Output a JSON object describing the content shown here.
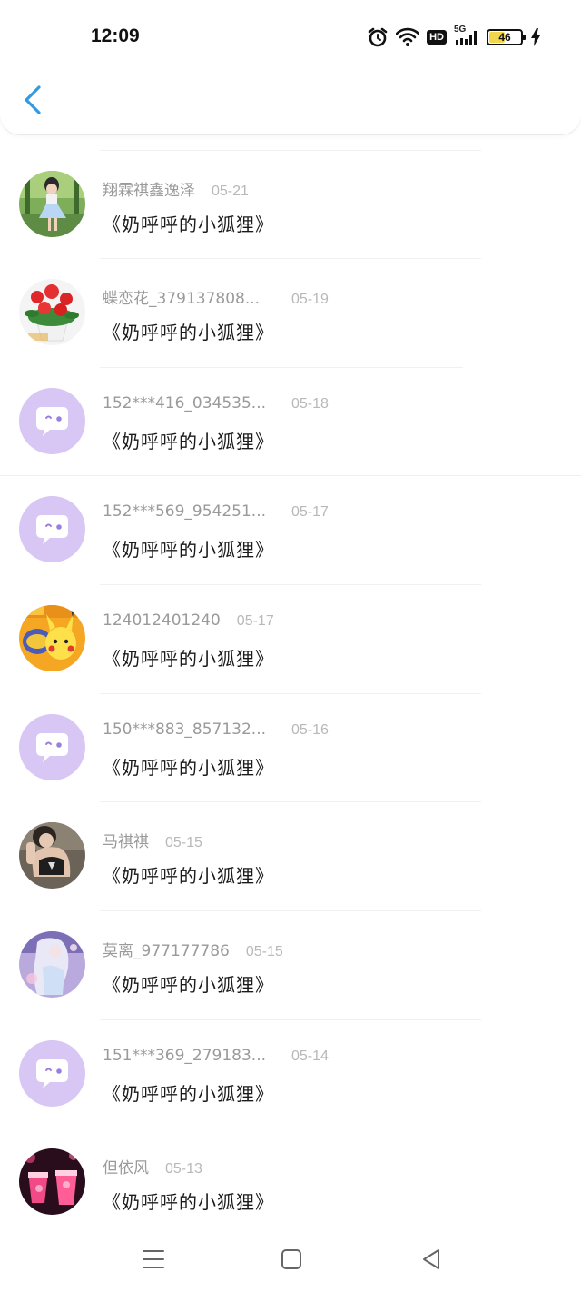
{
  "status_bar": {
    "time": "12:09",
    "hd_label": "HD",
    "network_label": "5G",
    "battery_level": "46",
    "battery_fraction": 0.46,
    "icons": [
      "alarm-icon",
      "wifi-icon",
      "hd-icon",
      "signal-icon",
      "battery-icon",
      "charging-icon"
    ]
  },
  "header": {
    "back_icon": "chevron-left-icon",
    "accent": "#2f9be3"
  },
  "list": {
    "items": [
      {
        "name": "翔霖祺鑫逸泽",
        "date": "05-21",
        "text": "《奶呼呼的小狐狸》",
        "avatar": "photo-girl-dress"
      },
      {
        "name": "蝶恋花_379137808...",
        "date": "05-19",
        "text": "《奶呼呼的小狐狸》",
        "avatar": "photo-flowers"
      },
      {
        "name": "152***416_034535...",
        "date": "05-18",
        "text": "《奶呼呼的小狐狸》",
        "avatar": "default-chat-avatar"
      },
      {
        "name": "152***569_954251...",
        "date": "05-17",
        "text": "《奶呼呼的小狐狸》",
        "avatar": "default-chat-avatar"
      },
      {
        "name": "124012401240",
        "date": "05-17",
        "text": "《奶呼呼的小狐狸》",
        "avatar": "photo-pikachu"
      },
      {
        "name": "150***883_857132...",
        "date": "05-16",
        "text": "《奶呼呼的小狐狸》",
        "avatar": "default-chat-avatar"
      },
      {
        "name": "马祺祺",
        "date": "05-15",
        "text": "《奶呼呼的小狐狸》",
        "avatar": "photo-woman"
      },
      {
        "name": "莫离_977177786",
        "date": "05-15",
        "text": "《奶呼呼的小狐狸》",
        "avatar": "photo-anime"
      },
      {
        "name": "151***369_279183...",
        "date": "05-14",
        "text": "《奶呼呼的小狐狸》",
        "avatar": "default-chat-avatar"
      },
      {
        "name": "但依风",
        "date": "05-13",
        "text": "《奶呼呼的小狐狸》",
        "avatar": "photo-drinks"
      }
    ]
  },
  "nav_bar": {
    "icons": [
      "menu-icon",
      "home-square-icon",
      "back-triangle-icon"
    ]
  },
  "colors": {
    "default_avatar_bg": "#d8c6f5",
    "default_avatar_fg": "#ffffff",
    "default_avatar_accent": "#9b7fe0",
    "name_gray": "#9a9a9a",
    "date_gray": "#b8b8b8"
  }
}
